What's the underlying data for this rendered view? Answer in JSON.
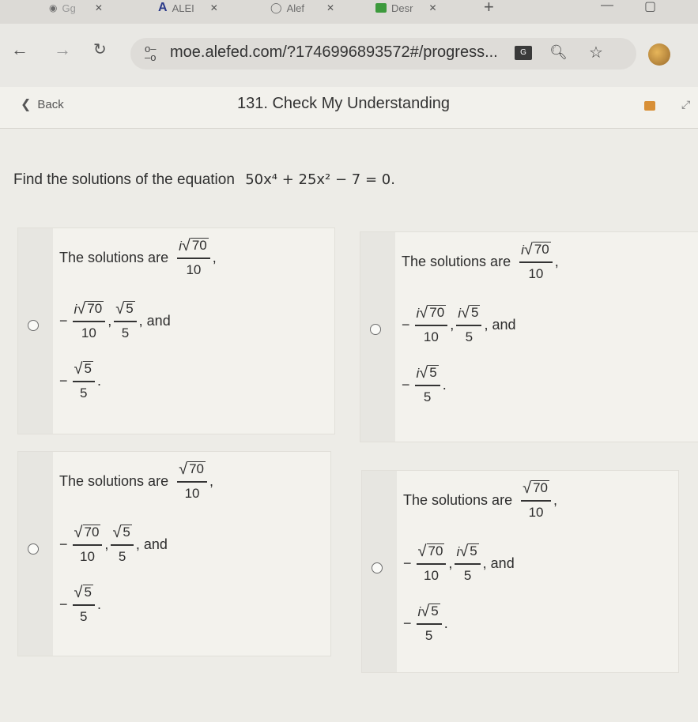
{
  "browser": {
    "tabs": [
      {
        "label": "ALEI"
      },
      {
        "label": "Alef"
      },
      {
        "label": "Desr"
      }
    ],
    "new_tab": "+",
    "url": "moe.alefed.com/?1746996893572#/progress..."
  },
  "header": {
    "back_label": "Back",
    "title": "131. Check My Understanding"
  },
  "question": {
    "prompt": "Find the solutions of the equation",
    "equation": "50x⁴ + 25x² − 7 = 0."
  },
  "options": [
    {
      "intro": "The solutions are",
      "first": {
        "imag": true,
        "num": "70",
        "den": "10"
      },
      "second": {
        "imag": true,
        "num": "70",
        "den": "10"
      },
      "third": {
        "imag": false,
        "num": "5",
        "den": "5"
      },
      "fourth": {
        "imag": false,
        "num": "5",
        "den": "5"
      },
      "and_label": ", and"
    },
    {
      "intro": "The solutions are",
      "first": {
        "imag": true,
        "num": "70",
        "den": "10"
      },
      "second": {
        "imag": true,
        "num": "70",
        "den": "10"
      },
      "third": {
        "imag": true,
        "num": "5",
        "den": "5"
      },
      "fourth": {
        "imag": true,
        "num": "5",
        "den": "5"
      },
      "and_label": ", and"
    },
    {
      "intro": "The solutions are",
      "first": {
        "imag": false,
        "num": "70",
        "den": "10"
      },
      "second": {
        "imag": false,
        "num": "70",
        "den": "10"
      },
      "third": {
        "imag": false,
        "num": "5",
        "den": "5"
      },
      "fourth": {
        "imag": false,
        "num": "5",
        "den": "5"
      },
      "and_label": ", and"
    },
    {
      "intro": "The solutions are",
      "first": {
        "imag": false,
        "num": "70",
        "den": "10"
      },
      "second": {
        "imag": false,
        "num": "70",
        "den": "10"
      },
      "third": {
        "imag": true,
        "num": "5",
        "den": "5"
      },
      "fourth": {
        "imag": true,
        "num": "5",
        "den": "5"
      },
      "and_label": ", and"
    }
  ]
}
